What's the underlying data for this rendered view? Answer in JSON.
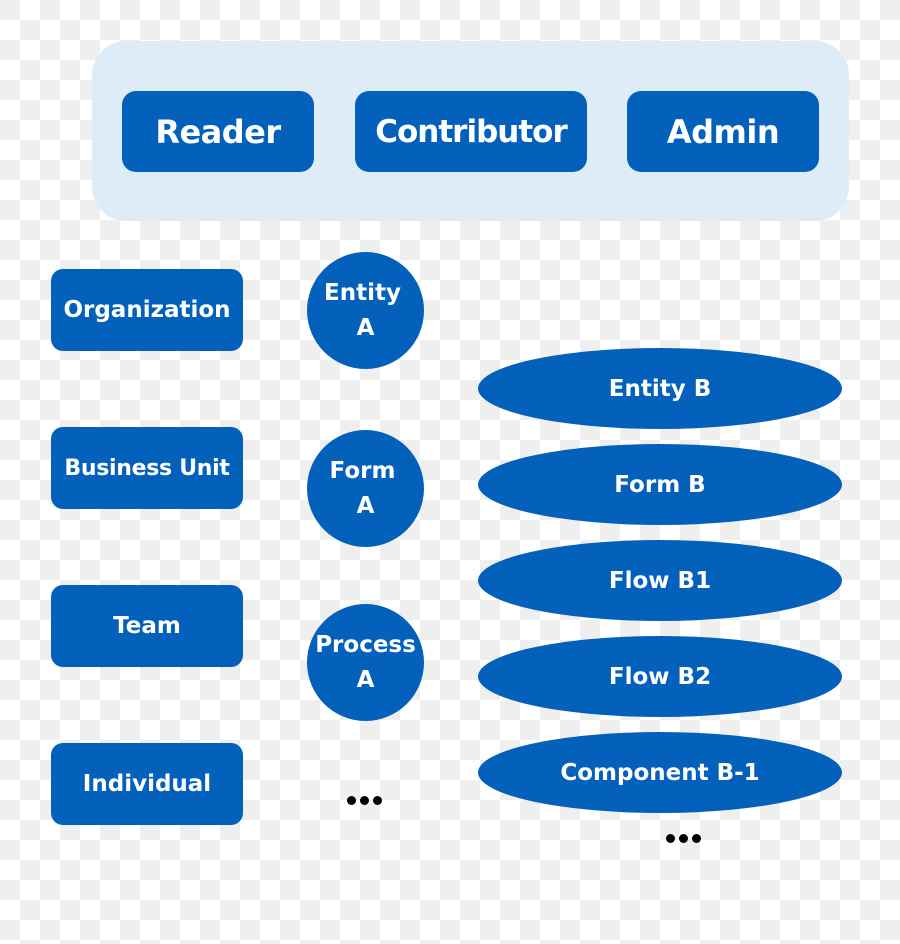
{
  "colors": {
    "node_fill": "#0361bb",
    "panel_fill": "#deecf8",
    "text": "#ffffff",
    "ellipsis": "#000000"
  },
  "roles": [
    {
      "label": "Reader"
    },
    {
      "label": "Contributor"
    },
    {
      "label": "Admin"
    }
  ],
  "levels": [
    {
      "label": "Organization"
    },
    {
      "label": "Business Unit"
    },
    {
      "label": "Team"
    },
    {
      "label": "Individual"
    }
  ],
  "resources_a": [
    {
      "line1": "Entity",
      "line2": "A"
    },
    {
      "line1": "Form",
      "line2": "A"
    },
    {
      "line1": "Process",
      "line2": "A"
    }
  ],
  "resources_a_more": "more-items",
  "resources_b": [
    {
      "label": "Entity B"
    },
    {
      "label": "Form B"
    },
    {
      "label": "Flow B1"
    },
    {
      "label": "Flow B2"
    },
    {
      "label": "Component B-1"
    }
  ],
  "resources_b_more": "more-items"
}
